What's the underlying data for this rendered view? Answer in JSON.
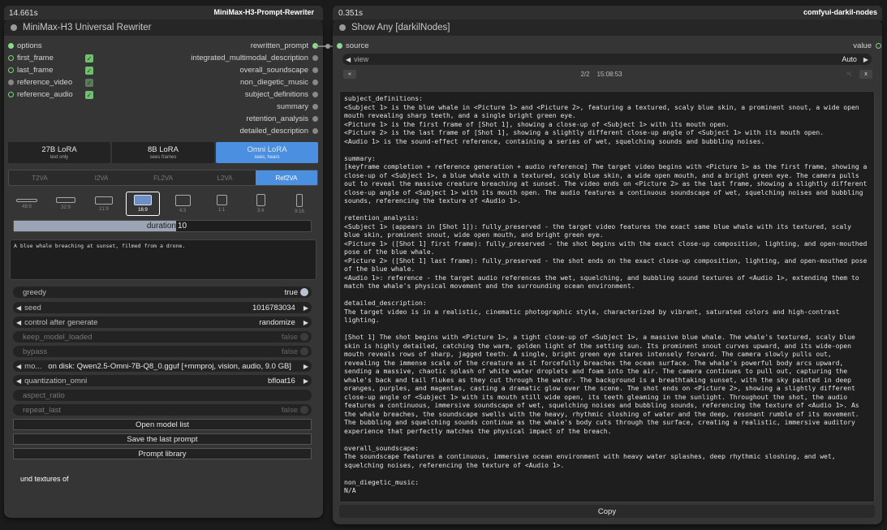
{
  "left_node": {
    "timer": "14.661s",
    "repo": "MiniMax-H3-Prompt-Rewriter",
    "title": "MiniMax-H3 Universal Rewriter",
    "inputs": [
      {
        "label": "options",
        "checked": null
      },
      {
        "label": "first_frame",
        "checked": true
      },
      {
        "label": "last_frame",
        "checked": true
      },
      {
        "label": "reference_video",
        "checked": true
      },
      {
        "label": "reference_audio",
        "checked": true
      }
    ],
    "outputs": [
      "rewritten_prompt",
      "integrated_multimodal_description",
      "overall_soundscape",
      "non_diegetic_music",
      "subject_definitions",
      "summary",
      "retention_analysis",
      "detailed_description"
    ],
    "model_tabs": [
      {
        "label": "27B LoRA",
        "sub": "text only"
      },
      {
        "label": "8B LoRA",
        "sub": "sees frames"
      },
      {
        "label": "Omni LoRA",
        "sub": "sees, hears"
      }
    ],
    "modes": [
      "T2VA",
      "I2VA",
      "FL2VA",
      "L2VA",
      "Ref2VA"
    ],
    "aspects": [
      "48:9",
      "32:9",
      "21:9",
      "16:9",
      "4:3",
      "1:1",
      "3:4",
      "9:16"
    ],
    "duration_label": "duration",
    "duration_value": "10",
    "prompt_text": "A blue whale breaching at sunset, filmed from a drone.",
    "widgets": {
      "greedy": {
        "name": "greedy",
        "value": "true"
      },
      "seed": {
        "name": "seed",
        "value": "1016783034"
      },
      "control": {
        "name": "control after generate",
        "value": "randomize"
      },
      "keep": {
        "name": "keep_model_loaded",
        "value": "false"
      },
      "bypass": {
        "name": "bypass",
        "value": "false"
      },
      "model": {
        "name": "mo...",
        "value": "on disk: Qwen2.5-Omni-7B-Q8_0.gguf [+mmproj, vision, audio, 9.0 GB]"
      },
      "quant": {
        "name": "quantization_omni",
        "value": "bfloat16"
      },
      "aspect_ratio": {
        "name": "aspect_ratio",
        "value": ""
      },
      "repeat": {
        "name": "repeat_last",
        "value": "false"
      }
    },
    "buttons": [
      "Open model list",
      "Save the last prompt",
      "Prompt library"
    ],
    "footer_text": "und textures of"
  },
  "right_node": {
    "timer": "0.351s",
    "repo": "comfyui-darkil-nodes",
    "title": "Show Any [darkilNodes]",
    "input_label": "source",
    "output_label": "value",
    "view_label": "view",
    "view_value": "Auto",
    "prev": "«",
    "page": "2/2",
    "time": "15:08:53",
    "next_end": ">|",
    "close": "x",
    "copy_label": "Copy",
    "output_text": "subject_definitions:\n<Subject 1> is the blue whale in <Picture 1> and <Picture 2>, featuring a textured, scaly blue skin, a prominent snout, a wide open mouth revealing sharp teeth, and a single bright green eye.\n<Picture 1> is the first frame of [Shot 1], showing a close-up of <Subject 1> with its mouth open.\n<Picture 2> is the last frame of [Shot 1], showing a slightly different close-up angle of <Subject 1> with its mouth open.\n<Audio 1> is the sound-effect reference, containing a series of wet, squelching sounds and bubbling noises.\n\nsummary:\n[keyframe completion + reference generation + audio reference] The target video begins with <Picture 1> as the first frame, showing a close-up of <Subject 1>, a blue whale with a textured, scaly blue skin, a wide open mouth, and a bright green eye. The camera pulls out to reveal the massive creature breaching at sunset. The video ends on <Picture 2> as the last frame, showing a slightly different close-up angle of <Subject 1> with its mouth open. The audio features a continuous soundscape of wet, squelching noises and bubbling sounds, referencing the texture of <Audio 1>.\n\nretention_analysis:\n<Subject 1> (appears in [Shot 1]): fully_preserved - the target video features the exact same blue whale with its textured, scaly blue skin, prominent snout, wide open mouth, and bright green eye.\n<Picture 1> ([Shot 1] first frame): fully_preserved - the shot begins with the exact close-up composition, lighting, and open-mouthed pose of the blue whale.\n<Picture 2> ([Shot 1] last frame): fully_preserved - the shot ends on the exact close-up composition, lighting, and open-mouthed pose of the blue whale.\n<Audio 1>: reference - the target audio references the wet, squelching, and bubbling sound textures of <Audio 1>, extending them to match the whale's physical movement and the surrounding ocean environment.\n\ndetailed_description:\nThe target video is in a realistic, cinematic photographic style, characterized by vibrant, saturated colors and high-contrast lighting.\n\n[Shot 1] The shot begins with <Picture 1>, a tight close-up of <Subject 1>, a massive blue whale. The whale's textured, scaly blue skin is highly detailed, catching the warm, golden light of the setting sun. Its prominent snout curves upward, and its wide-open mouth reveals rows of sharp, jagged teeth. A single, bright green eye stares intensely forward. The camera slowly pulls out, revealing the immense scale of the creature as it forcefully breaches the ocean surface. The whale's powerful body arcs upward, sending a massive, chaotic splash of white water droplets and foam into the air. The camera continues to pull out, capturing the whale's back and tail flukes as they cut through the water. The background is a breathtaking sunset, with the sky painted in deep oranges, purples, and magentas, casting a dramatic glow over the scene. The shot ends on <Picture 2>, showing a slightly different close-up angle of <Subject 1> with its mouth still wide open, its teeth gleaming in the sunlight. Throughout the shot, the audio features a continuous, immersive soundscape of wet, squelching noises and bubbling sounds, referencing the texture of <Audio 1>. As the whale breaches, the soundscape swells with the heavy, rhythmic sloshing of water and the deep, resonant rumble of its movement. The bubbling and squelching sounds continue as the whale's body cuts through the surface, creating a realistic, immersive auditory experience that perfectly matches the physical impact of the breach.\n\noverall_soundscape:\nThe soundscape features a continuous, immersive ocean environment with heavy water splashes, deep rhythmic sloshing, and wet, squelching noises, referencing the texture of <Audio 1>.\n\nnon_diegetic_music:\nN/A"
  },
  "colors": {
    "accent": "#4a8fe0",
    "port_green": "#7bd47b",
    "node_bg": "#353535",
    "canvas_bg": "#1b1b1b"
  }
}
